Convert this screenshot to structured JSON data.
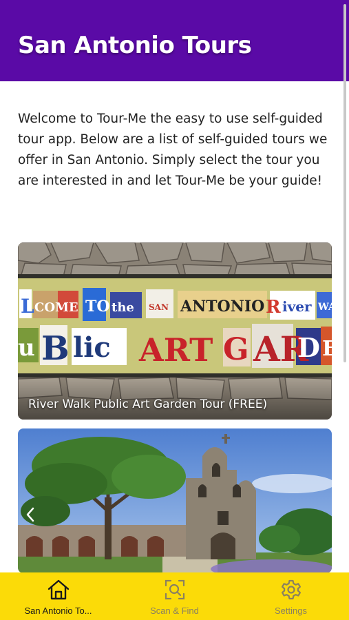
{
  "header": {
    "title": "San Antonio Tours"
  },
  "intro": {
    "text": "Welcome to Tour-Me the easy to use self-guided tour app. Below are a list of self-guided tours we offer in San Antonio. Simply select the tour you are interested in and let Tour-Me be your guide!"
  },
  "tours": [
    {
      "caption": "River Walk Public Art Garden Tour (FREE)",
      "sign_text": [
        "LCOME",
        "TO",
        "the",
        "SAN",
        "ANTONIO",
        "River",
        "WA",
        "uBlic",
        "ART",
        "GARD"
      ]
    },
    {
      "caption": ""
    }
  ],
  "tabbar": {
    "tabs": [
      {
        "label": "San Antonio To...",
        "icon": "home-icon",
        "active": true
      },
      {
        "label": "Scan & Find",
        "icon": "scan-icon",
        "active": false
      },
      {
        "label": "Settings",
        "icon": "gear-icon",
        "active": false
      }
    ]
  },
  "colors": {
    "header": "#5a0aa6",
    "tabbar": "#fbdb08",
    "text": "#222222"
  }
}
